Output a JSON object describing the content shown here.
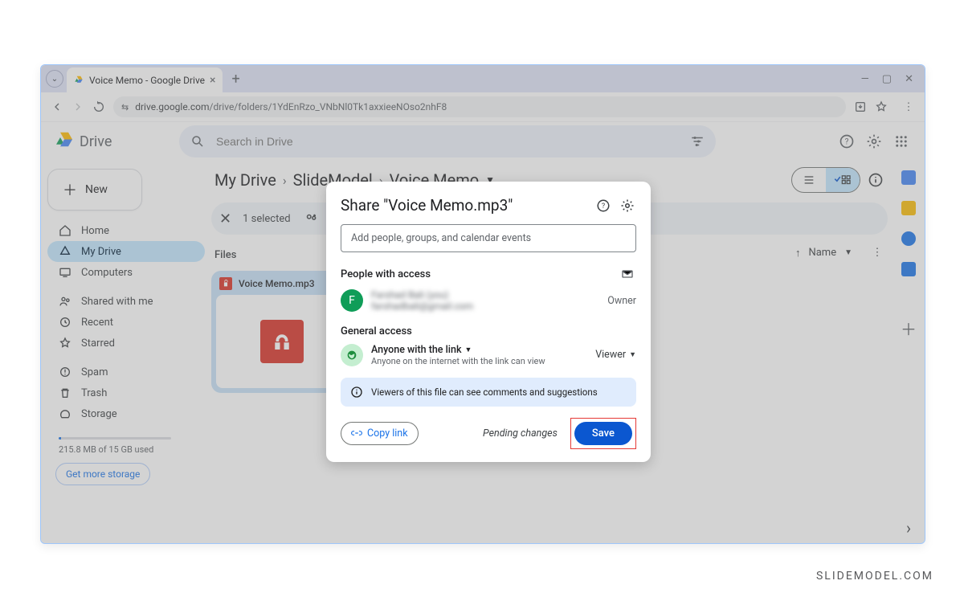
{
  "browser": {
    "tab_title": "Voice Memo - Google Drive",
    "url_safe": "drive.google.com",
    "url_rest": "/drive/folders/1YdEnRzo_VNbNl0Tk1axxieeNOso2nhF8"
  },
  "drive": {
    "product": "Drive",
    "search_placeholder": "Search in Drive",
    "new_button": "New",
    "nav": {
      "home": "Home",
      "mydrive": "My Drive",
      "computers": "Computers",
      "shared": "Shared with me",
      "recent": "Recent",
      "starred": "Starred",
      "spam": "Spam",
      "trash": "Trash",
      "storage": "Storage"
    },
    "storage_text": "215.8 MB of 15 GB used",
    "get_more": "Get more storage",
    "breadcrumb": {
      "a": "My Drive",
      "b": "SlideModel",
      "c": "Voice Memo"
    },
    "selection_bar": {
      "count_label": "1 selected"
    },
    "files_label": "Files",
    "sort_col": "Name",
    "file": {
      "name": "Voice Memo.mp3"
    }
  },
  "share": {
    "title": "Share \"Voice Memo.mp3\"",
    "input_placeholder": "Add people, groups, and calendar events",
    "people_section": "People with access",
    "owner_label": "Owner",
    "general_section": "General access",
    "scope_title": "Anyone with the link",
    "scope_sub": "Anyone on the internet with the link can view",
    "role": "Viewer",
    "banner": "Viewers of this file can see comments and suggestions",
    "copy_link": "Copy link",
    "pending": "Pending changes",
    "save": "Save"
  },
  "watermark": "SLIDEMODEL.COM"
}
